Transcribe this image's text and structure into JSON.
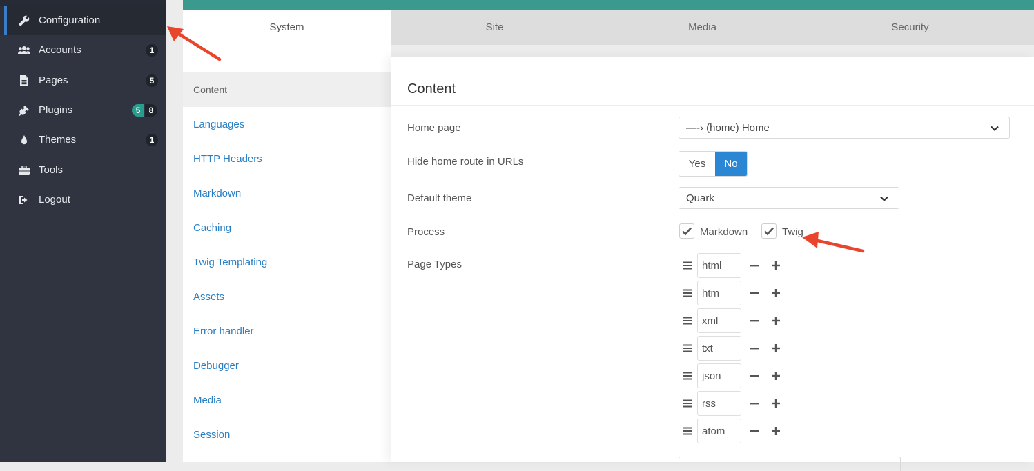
{
  "sidebar": {
    "items": [
      {
        "label": "Configuration",
        "icon": "wrench-icon",
        "badges": []
      },
      {
        "label": "Accounts",
        "icon": "users-icon",
        "badges": [
          "1"
        ]
      },
      {
        "label": "Pages",
        "icon": "file-icon",
        "badges": [
          "5"
        ]
      },
      {
        "label": "Plugins",
        "icon": "plug-icon",
        "badges": [
          "5",
          "8"
        ]
      },
      {
        "label": "Themes",
        "icon": "tint-icon",
        "badges": [
          "1"
        ]
      },
      {
        "label": "Tools",
        "icon": "briefcase-icon",
        "badges": []
      },
      {
        "label": "Logout",
        "icon": "sign-out-icon",
        "badges": []
      }
    ]
  },
  "tabs": [
    "System",
    "Site",
    "Media",
    "Security"
  ],
  "sections": {
    "header": "Content",
    "links": [
      "Languages",
      "HTTP Headers",
      "Markdown",
      "Caching",
      "Twig Templating",
      "Assets",
      "Error handler",
      "Debugger",
      "Media",
      "Session"
    ]
  },
  "content": {
    "title": "Content",
    "home_page": {
      "label": "Home page",
      "value": "—-› (home) Home"
    },
    "hide_home": {
      "label": "Hide home route in URLs",
      "yes": "Yes",
      "no": "No",
      "selected": "No"
    },
    "default_theme": {
      "label": "Default theme",
      "value": "Quark"
    },
    "process": {
      "label": "Process",
      "options": [
        {
          "label": "Markdown",
          "checked": true
        },
        {
          "label": "Twig",
          "checked": true
        }
      ]
    },
    "page_types": {
      "label": "Page Types",
      "values": [
        "html",
        "htm",
        "xml",
        "txt",
        "json",
        "rss",
        "atom"
      ]
    }
  },
  "colors": {
    "accent_blue": "#2b86d3",
    "teal": "#3a9a8e",
    "sidebar": "#2f3440",
    "arrow": "#e8452c"
  }
}
